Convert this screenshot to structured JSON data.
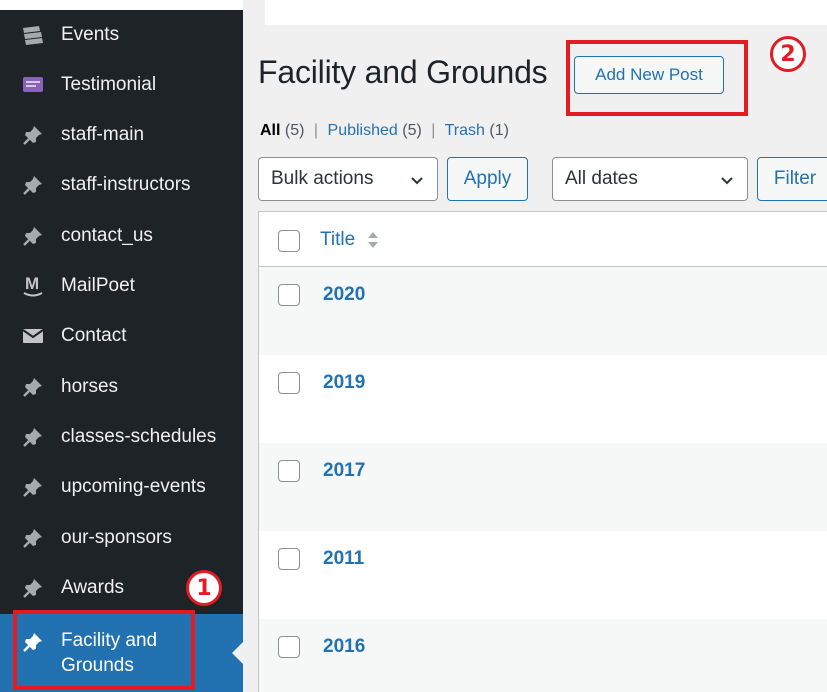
{
  "sidebar": {
    "items": [
      {
        "label": "Events",
        "icon": "events-icon"
      },
      {
        "label": "Testimonial",
        "icon": "testimonial-icon"
      },
      {
        "label": "staff-main",
        "icon": "pin-icon"
      },
      {
        "label": "staff-instructors",
        "icon": "pin-icon"
      },
      {
        "label": "contact_us",
        "icon": "pin-icon"
      },
      {
        "label": "MailPoet",
        "icon": "mailpoet-icon"
      },
      {
        "label": "Contact",
        "icon": "envelope-icon"
      },
      {
        "label": "horses",
        "icon": "pin-icon"
      },
      {
        "label": "classes-schedules",
        "icon": "pin-icon"
      },
      {
        "label": "upcoming-events",
        "icon": "pin-icon"
      },
      {
        "label": "our-sponsors",
        "icon": "pin-icon"
      },
      {
        "label": "Awards",
        "icon": "pin-icon"
      },
      {
        "label": "Facility and Grounds",
        "icon": "pin-icon",
        "current": true
      }
    ]
  },
  "header": {
    "title": "Facility and Grounds",
    "add_new_label": "Add New Post"
  },
  "filters": {
    "all_label": "All",
    "all_count": "(5)",
    "published_label": "Published",
    "published_count": "(5)",
    "trash_label": "Trash",
    "trash_count": "(1)",
    "separator": "|"
  },
  "toolbar": {
    "bulk_actions": "Bulk actions",
    "apply_label": "Apply",
    "dates": "All dates",
    "filter_label": "Filter"
  },
  "table": {
    "column_title": "Title",
    "rows": [
      {
        "title": "2020"
      },
      {
        "title": "2019"
      },
      {
        "title": "2017"
      },
      {
        "title": "2011"
      },
      {
        "title": "2016"
      }
    ]
  },
  "annotations": {
    "step1": "1",
    "step2": "2"
  },
  "colors": {
    "sidebar_bg": "#1d2327",
    "sidebar_current": "#2271b1",
    "link": "#2271b1",
    "annotation_red": "#e31c23"
  }
}
